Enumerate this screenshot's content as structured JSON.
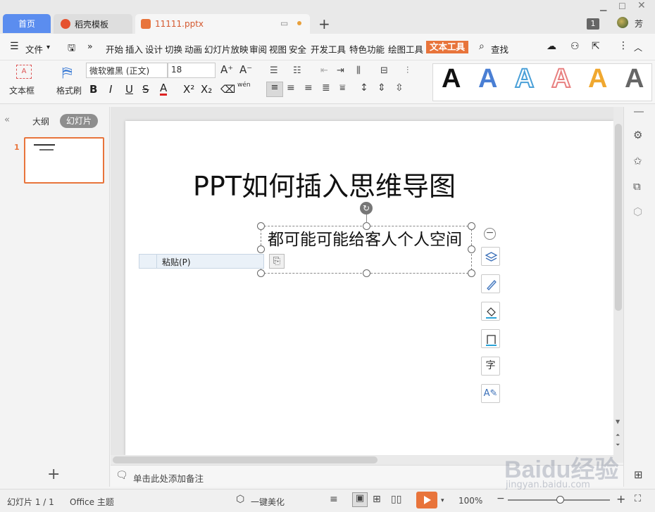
{
  "tabs": {
    "home": "首页",
    "template": "稻壳模板",
    "file": "11111.pptx"
  },
  "window": {
    "count_badge": "1",
    "user_name": "芳"
  },
  "menubar": {
    "file_label": "文件",
    "items": [
      "开始",
      "插入",
      "设计",
      "切换",
      "动画",
      "幻灯片放映",
      "审阅",
      "视图",
      "安全",
      "开发工具",
      "特色功能",
      "绘图工具"
    ],
    "active_tab": "文本工具",
    "search_label": "查找"
  },
  "ribbon": {
    "textbox_label": "文本框",
    "format_painter_label": "格式刷",
    "font_name": "微软雅黑 (正文)",
    "font_size": "18",
    "format_buttons": [
      "B",
      "I",
      "U",
      "S",
      "A",
      "X²",
      "X₂"
    ],
    "wen_label": "wén",
    "gallery_letters": [
      "A",
      "A",
      "A",
      "A",
      "A",
      "A"
    ]
  },
  "left_panel": {
    "outline_tab": "大纲",
    "slides_tab": "幻灯片",
    "slide_number": "1"
  },
  "slide": {
    "title": "PPT如何插入思维导图",
    "textbox_text": "都可能可能给客人个人空间"
  },
  "context_menu": {
    "paste_label": "粘贴(P)"
  },
  "notes": {
    "placeholder": "单击此处添加备注"
  },
  "status": {
    "slide_counter": "幻灯片 1 / 1",
    "theme": "Office 主题",
    "beautify": "一键美化",
    "zoom": "100%"
  },
  "watermark": {
    "text": "Baidu经验",
    "url": "jingyan.baidu.com"
  },
  "colors": {
    "accent": "#e8743b",
    "home_tab": "#5b8def"
  }
}
